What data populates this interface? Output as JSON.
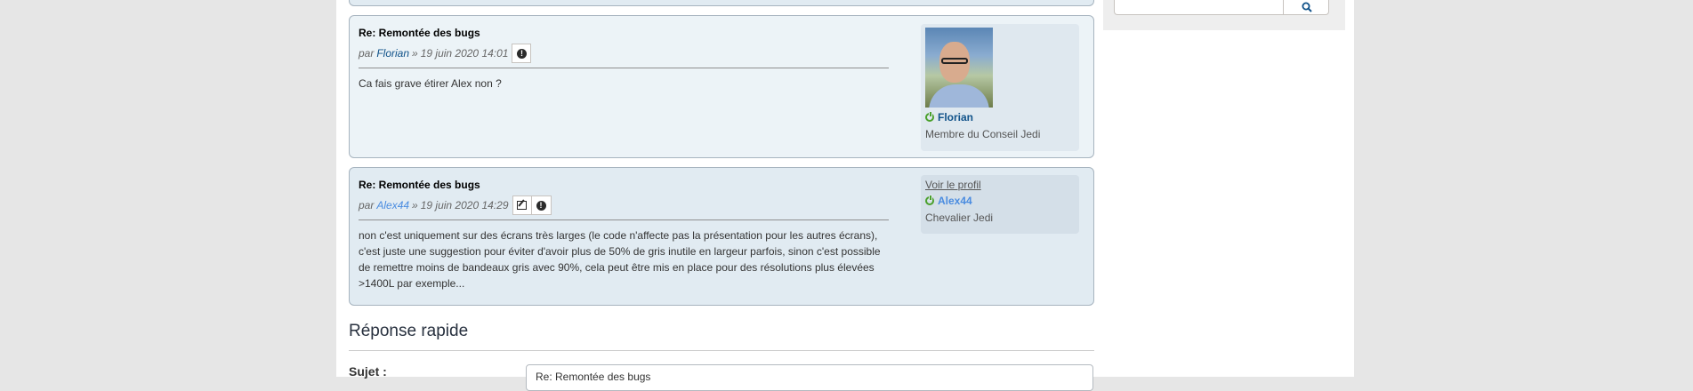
{
  "colors": {
    "page_bg": "#e6e6e6",
    "post_bg_1": "#ecf3f7",
    "post_bg_2": "#e1ebf2",
    "link": "#105289",
    "link_light": "#4a8ce0",
    "online": "#4aa02c"
  },
  "sidebar": {
    "search": {
      "value": "",
      "button_icon": "search-icon"
    }
  },
  "posts": [
    {
      "title": "Re: Remontée des bugs",
      "by": "par",
      "author": "Florian",
      "separator": "»",
      "date": "19 juin 2020 14:01",
      "buttons": [
        "report-icon"
      ],
      "content": "Ca fais grave étirer Alex non ?",
      "profile": {
        "has_avatar": true,
        "online_icon": "online-icon",
        "name": "Florian",
        "rank": "Membre du Conseil Jedi"
      }
    },
    {
      "title": "Re: Remontée des bugs",
      "by": "par",
      "author": "Alex44",
      "separator": "»",
      "date": "19 juin 2020 14:29",
      "buttons": [
        "edit-icon",
        "report-icon"
      ],
      "content": "non c'est uniquement sur des écrans très larges (le code n'affecte pas la présentation pour les autres écrans), c'est juste une suggestion pour éviter d'avoir plus de 50% de gris inutile en largeur parfois, sinon c'est possible de remettre moins de bandeaux gris avec 90%, cela peut être mis en place pour des résolutions plus élevées >1400L par exemple...",
      "profile": {
        "profile_link": "Voir le profil",
        "online_icon": "online-icon",
        "name": "Alex44",
        "rank": "Chevalier Jedi"
      }
    }
  ],
  "quick_reply": {
    "title": "Réponse rapide",
    "subject_label": "Sujet :",
    "subject_value": "Re: Remontée des bugs"
  }
}
